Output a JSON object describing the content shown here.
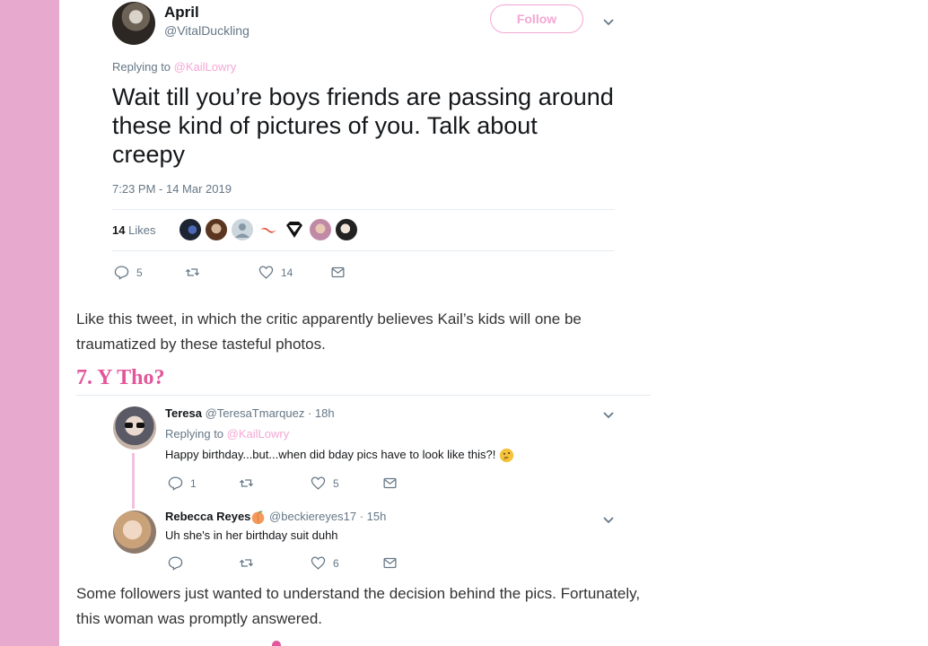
{
  "tweet1": {
    "name": "April",
    "handle": "@VitalDuckling",
    "follow_label": "Follow",
    "replying_prefix": "Replying to",
    "replying_handle": "@KailLowry",
    "text": "Wait till you’re boys friends are passing around these kind of pictures of you. Talk about creepy",
    "timestamp": "7:23 PM - 14 Mar 2019",
    "likes_number": "14",
    "likes_word": "Likes",
    "actions": {
      "reply_count": "5",
      "retweet_count": "",
      "like_count": "14"
    }
  },
  "paragraph1": "Like this tweet, in which the critic apparently believes Kail’s kids will one be traumatized by these tasteful photos.",
  "heading": "7. Y Tho?",
  "thread": [
    {
      "name": "Teresa",
      "handle": "@TeresaTmarquez",
      "time": "· 18h",
      "replying_prefix": "Replying to",
      "replying_handle": "@KailLowry",
      "text": "Happy birthday...but...when did bday pics have to look like this?!",
      "emoji": "thinking-face",
      "reply_count": "1",
      "retweet_count": "",
      "like_count": "5"
    },
    {
      "name": "Rebecca Reyes",
      "name_emoji": "peach",
      "handle": "@beckiereyes17",
      "time": "· 15h",
      "text": "Uh she's in her birthday suit duhh",
      "reply_count": "",
      "retweet_count": "",
      "like_count": "6"
    }
  ],
  "paragraph2": "Some followers just wanted to understand the decision behind the pics. Fortunately, this woman was promptly answered.",
  "colors": {
    "sidebar": "#e8a9cf",
    "accent_pink": "#f4a7d4",
    "heading_pink": "#e2579b",
    "muted_text": "#657786"
  }
}
